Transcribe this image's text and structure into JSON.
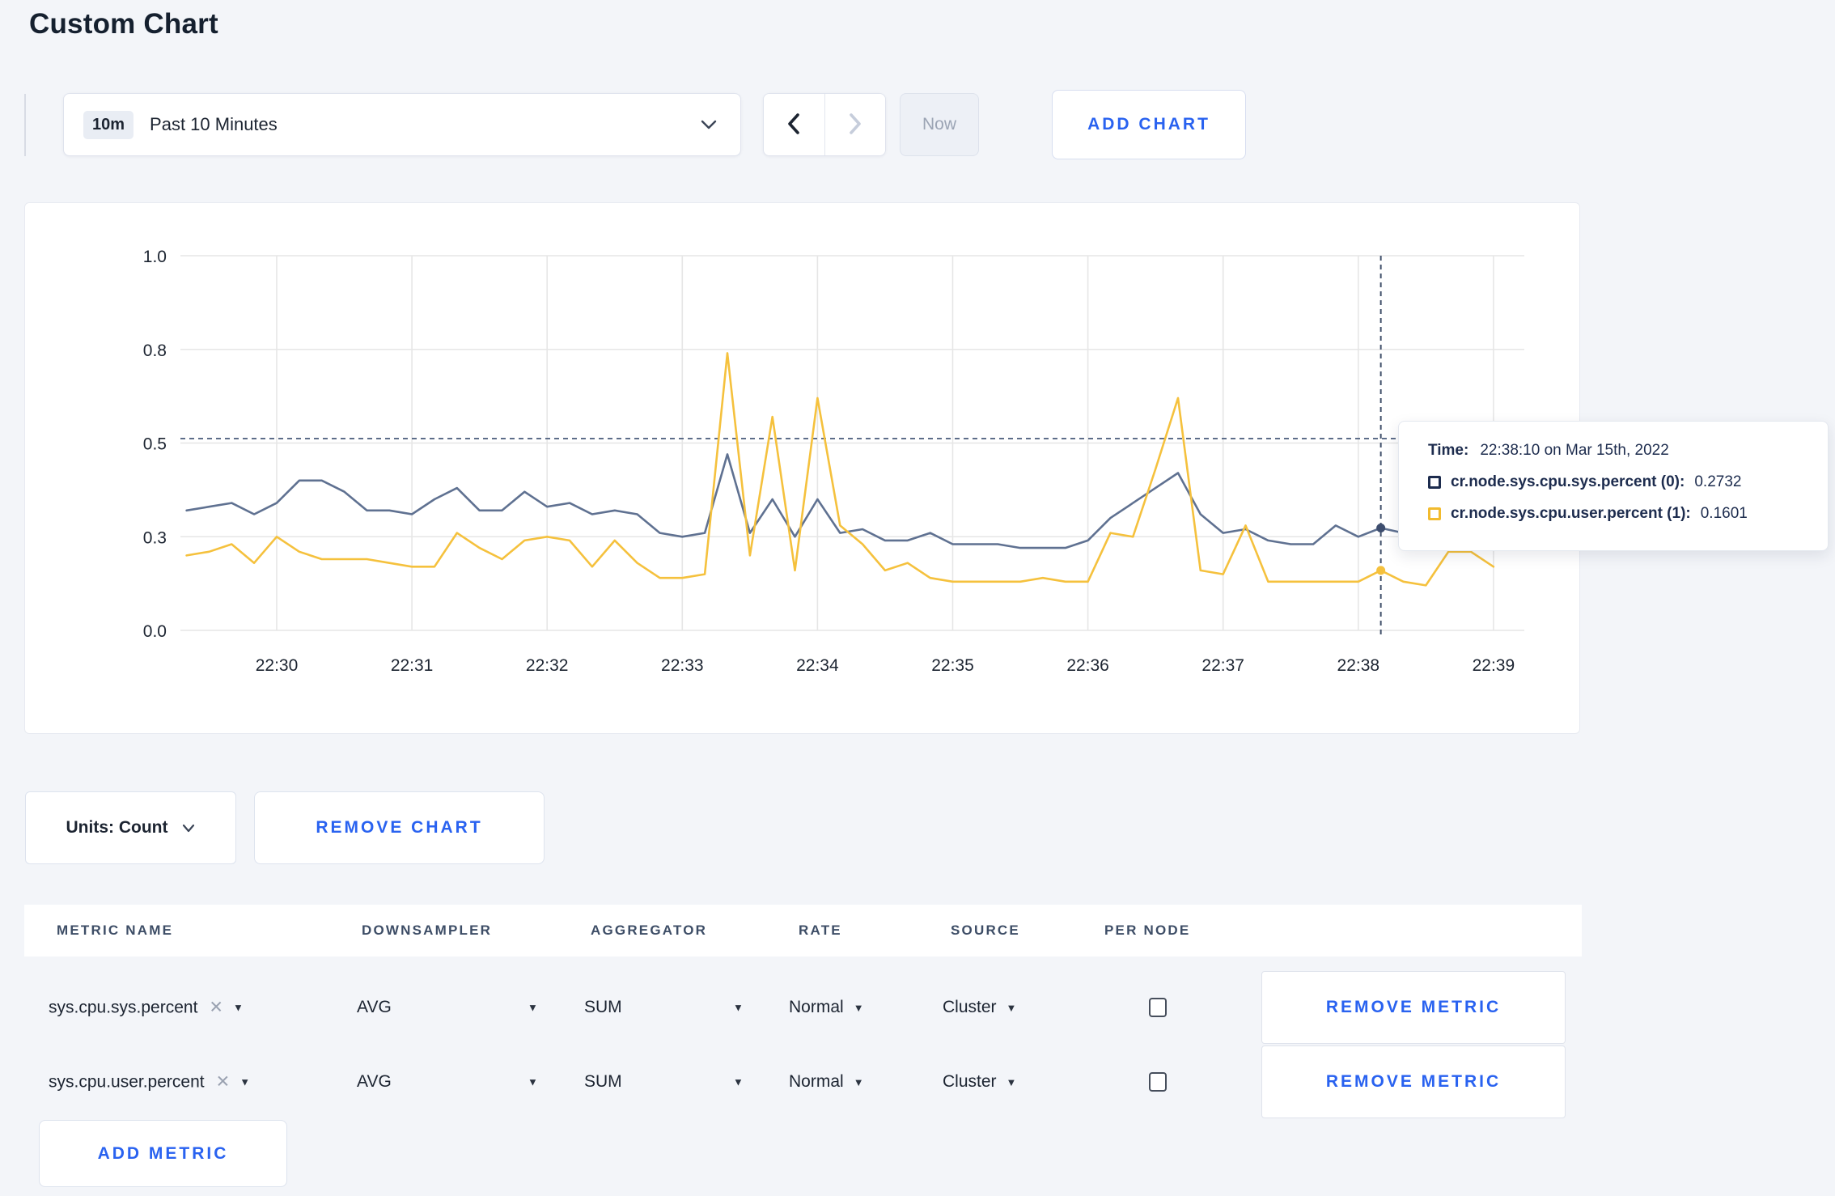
{
  "page": {
    "title": "Custom Chart"
  },
  "toolbar": {
    "time_badge": "10m",
    "time_label": "Past 10 Minutes",
    "now_label": "Now",
    "add_chart_label": "ADD CHART"
  },
  "chart": {
    "tooltip": {
      "time_label": "Time:",
      "time_value": "22:38:10 on Mar 15th, 2022",
      "series": [
        {
          "name": "cr.node.sys.cpu.sys.percent (0):",
          "value": "0.2732",
          "swatch_color": "#1d2c4e"
        },
        {
          "name": "cr.node.sys.cpu.user.percent (1):",
          "value": "0.1601",
          "swatch_color": "#f2bb2e"
        }
      ]
    }
  },
  "chart_data": {
    "type": "line",
    "title": "",
    "xlabel": "",
    "ylabel": "",
    "ylim": [
      0,
      1
    ],
    "grid": true,
    "y_ticks": [
      0,
      0.25,
      0.5,
      0.75,
      1.0
    ],
    "y_tick_labels": [
      "0.0",
      "0.3",
      "0.5",
      "0.8",
      "1.0"
    ],
    "x_tick_labels": [
      "22:30",
      "22:31",
      "22:32",
      "22:33",
      "22:34",
      "22:35",
      "22:36",
      "22:37",
      "22:38",
      "22:39"
    ],
    "x": [
      "22:29:20",
      "22:29:30",
      "22:29:40",
      "22:29:50",
      "22:30:00",
      "22:30:10",
      "22:30:20",
      "22:30:30",
      "22:30:40",
      "22:30:50",
      "22:31:00",
      "22:31:10",
      "22:31:20",
      "22:31:30",
      "22:31:40",
      "22:31:50",
      "22:32:00",
      "22:32:10",
      "22:32:20",
      "22:32:30",
      "22:32:40",
      "22:32:50",
      "22:33:00",
      "22:33:10",
      "22:33:20",
      "22:33:30",
      "22:33:40",
      "22:33:50",
      "22:34:00",
      "22:34:10",
      "22:34:20",
      "22:34:30",
      "22:34:40",
      "22:34:50",
      "22:35:00",
      "22:35:10",
      "22:35:20",
      "22:35:30",
      "22:35:40",
      "22:35:50",
      "22:36:00",
      "22:36:10",
      "22:36:20",
      "22:36:30",
      "22:36:40",
      "22:36:50",
      "22:37:00",
      "22:37:10",
      "22:37:20",
      "22:37:30",
      "22:37:40",
      "22:37:50",
      "22:38:00",
      "22:38:10",
      "22:38:20",
      "22:38:30",
      "22:38:40",
      "22:38:50",
      "22:39:00"
    ],
    "series": [
      {
        "name": "cr.node.sys.cpu.sys.percent",
        "color": "#5f7191",
        "dot_color": "#3d4d6e",
        "values": [
          0.32,
          0.33,
          0.34,
          0.31,
          0.34,
          0.4,
          0.4,
          0.37,
          0.32,
          0.32,
          0.31,
          0.35,
          0.38,
          0.32,
          0.32,
          0.37,
          0.33,
          0.34,
          0.31,
          0.32,
          0.31,
          0.26,
          0.25,
          0.26,
          0.47,
          0.26,
          0.35,
          0.25,
          0.35,
          0.26,
          0.27,
          0.24,
          0.24,
          0.26,
          0.23,
          0.23,
          0.23,
          0.22,
          0.22,
          0.22,
          0.24,
          0.3,
          0.34,
          0.38,
          0.42,
          0.31,
          0.26,
          0.27,
          0.24,
          0.23,
          0.23,
          0.28,
          0.25,
          0.2732,
          0.26,
          0.26,
          0.27,
          0.26,
          0.3
        ]
      },
      {
        "name": "cr.node.sys.cpu.user.percent",
        "color": "#f5c13d",
        "dot_color": "#f5c13d",
        "values": [
          0.2,
          0.21,
          0.23,
          0.18,
          0.25,
          0.21,
          0.19,
          0.19,
          0.19,
          0.18,
          0.17,
          0.17,
          0.26,
          0.22,
          0.19,
          0.24,
          0.25,
          0.24,
          0.17,
          0.24,
          0.18,
          0.14,
          0.14,
          0.15,
          0.74,
          0.2,
          0.57,
          0.16,
          0.62,
          0.28,
          0.23,
          0.16,
          0.18,
          0.14,
          0.13,
          0.13,
          0.13,
          0.13,
          0.14,
          0.13,
          0.13,
          0.26,
          0.25,
          0.43,
          0.62,
          0.16,
          0.15,
          0.28,
          0.13,
          0.13,
          0.13,
          0.13,
          0.13,
          0.1601,
          0.13,
          0.12,
          0.21,
          0.21,
          0.17
        ]
      }
    ],
    "hover": {
      "time": "22:38:10",
      "hline_value": 0.512,
      "point_values": [
        0.2732,
        0.1601
      ]
    },
    "legend_position": "tooltip"
  },
  "controls": {
    "units_label": "Units: Count",
    "remove_chart_label": "REMOVE CHART",
    "add_metric_label": "ADD METRIC"
  },
  "metrics_table": {
    "headers": [
      "METRIC NAME",
      "DOWNSAMPLER",
      "AGGREGATOR",
      "RATE",
      "SOURCE",
      "PER NODE"
    ],
    "remove_metric_label": "REMOVE METRIC",
    "rows": [
      {
        "name": "sys.cpu.sys.percent",
        "downsampler": "AVG",
        "aggregator": "SUM",
        "rate": "Normal",
        "source": "Cluster",
        "per_node_checked": false
      },
      {
        "name": "sys.cpu.user.percent",
        "downsampler": "AVG",
        "aggregator": "SUM",
        "rate": "Normal",
        "source": "Cluster",
        "per_node_checked": false
      }
    ]
  }
}
